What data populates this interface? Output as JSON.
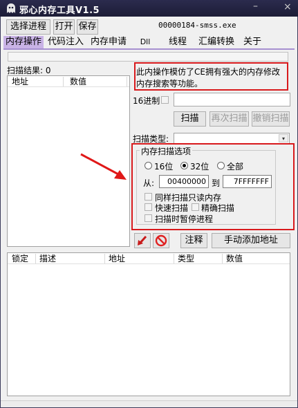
{
  "app": {
    "title": "邪心内存工具V1.5",
    "minimize": "–",
    "close": "×"
  },
  "toolbar": {
    "select_process": "选择进程",
    "open": "打开",
    "save": "保存",
    "process_name": "00000184-smss.exe"
  },
  "tabs": [
    {
      "label": "内存操作",
      "active": true
    },
    {
      "label": "代码注入",
      "active": false
    },
    {
      "label": "内存申请",
      "active": false
    },
    {
      "label": "Dll",
      "active": false
    },
    {
      "label": "线程",
      "active": false
    },
    {
      "label": "汇编转换",
      "active": false
    },
    {
      "label": "关于",
      "active": false
    }
  ],
  "results": {
    "label": "扫描结果: 0",
    "columns": [
      "地址",
      "数值"
    ]
  },
  "note": {
    "line1": "此内操作模仿了CE拥有强大的内存修改",
    "line2": "内存搜索等功能。"
  },
  "scan": {
    "hex_label": "16进制",
    "hex_value": "",
    "scan_btn": "扫描",
    "rescan_btn": "再次扫描",
    "undo_btn": "撤销扫描",
    "type_label": "扫描类型:",
    "type_value": ""
  },
  "options": {
    "title": "内存扫描选项",
    "radio_16": "16位",
    "radio_32": "32位",
    "radio_all": "全部",
    "from_label": "从:",
    "from_value": "00400000",
    "to_label": "到",
    "to_value": "7FFFFFFF",
    "chk_readonly": "同样扫描只读内存",
    "chk_fast": "快速扫描",
    "chk_exact": "精确扫描",
    "chk_pause": "扫描时暂停进程"
  },
  "actions": {
    "comment": "注释",
    "add_manual": "手动添加地址"
  },
  "saved": {
    "columns": [
      "锁定",
      "描述",
      "地址",
      "类型",
      "数值"
    ]
  },
  "colors": {
    "highlight_red": "#d8191c",
    "tab_active": "#c9b3e6",
    "title_bg": "#2b2b4e"
  },
  "icons": {
    "logo": "ghost-logo-icon",
    "arrow_to_list": "arrow-down-left-icon",
    "clear": "no-entry-icon",
    "annotation_arrow": "red-arrow-icon",
    "dropdown": "chevron-down-icon"
  }
}
